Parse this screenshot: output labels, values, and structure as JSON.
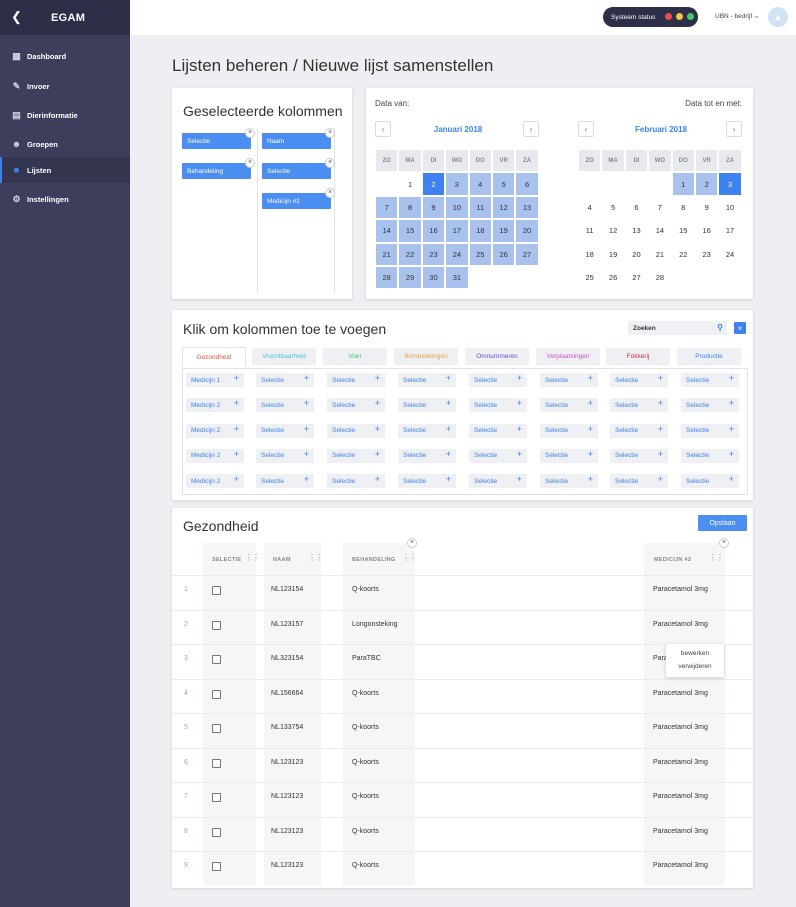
{
  "app": {
    "title": "EGAM",
    "back_icon": "chevron-left-icon"
  },
  "sidebar": {
    "items": [
      {
        "label": "Dashboard",
        "icon": "bar-chart-icon"
      },
      {
        "label": "Invoer",
        "icon": "edit-icon"
      },
      {
        "label": "Dierinformatie",
        "icon": "document-icon"
      },
      {
        "label": "Groepen",
        "icon": "group-icon"
      },
      {
        "label": "Lijsten",
        "icon": "list-icon",
        "active": true
      },
      {
        "label": "Instellingen",
        "icon": "gear-icon"
      }
    ]
  },
  "topbar": {
    "status_label": "Systeem status",
    "status_colors": [
      "#e84c4c",
      "#f5c542",
      "#4cc76a"
    ],
    "company": "UBN - bedrijf",
    "avatar_icon": "mountain-icon"
  },
  "page": {
    "title": "Lijsten beheren / Nieuwe lijst samenstellen"
  },
  "selected_columns": {
    "title": "Geselecteerde kolommen",
    "chips": [
      "Selectie",
      "Naam",
      "Behandeling",
      "Selectie",
      "Medicijn #2"
    ]
  },
  "calendar": {
    "from_label": "Data van:",
    "to_label": "Data tot en met:",
    "weekdays": [
      "ZO",
      "MA",
      "DI",
      "WO",
      "DO",
      "VR",
      "ZA"
    ],
    "left": {
      "month": "Januari 2018",
      "days": [
        "",
        "1",
        "2",
        "3",
        "4",
        "5",
        "6",
        "7",
        "8",
        "9",
        "10",
        "11",
        "12",
        "13",
        "14",
        "15",
        "16",
        "17",
        "18",
        "19",
        "20",
        "21",
        "22",
        "23",
        "24",
        "25",
        "26",
        "27",
        "28",
        "29",
        "30",
        "31",
        "",
        "",
        ""
      ],
      "selected": [
        "2"
      ],
      "range_from": "3",
      "range_to": "31"
    },
    "right": {
      "month": "Februari 2018",
      "days": [
        "",
        "",
        "",
        "",
        "1",
        "2",
        "3",
        "4",
        "5",
        "6",
        "7",
        "8",
        "9",
        "10",
        "11",
        "12",
        "13",
        "14",
        "15",
        "16",
        "17",
        "18",
        "19",
        "20",
        "21",
        "22",
        "23",
        "24",
        "25",
        "26",
        "27",
        "28",
        "",
        "",
        ""
      ],
      "selected": [
        "3"
      ],
      "range_from": "1",
      "range_to": "2"
    }
  },
  "add_columns": {
    "title": "Klik om kolommen toe te voegen",
    "search_placeholder": "Zoeken",
    "tabs": [
      {
        "label": "Gezondheid",
        "color": "#e8563c"
      },
      {
        "label": "Vruchtbaarheid",
        "color": "#4fc3d9"
      },
      {
        "label": "Voer",
        "color": "#3cc75f"
      },
      {
        "label": "Behandelingen",
        "color": "#f0a040"
      },
      {
        "label": "Omnummeren",
        "color": "#6a4ed8"
      },
      {
        "label": "Verplaatsingen",
        "color": "#d653c9"
      },
      {
        "label": "Fokkerij",
        "color": "#c7304a"
      },
      {
        "label": "Productie",
        "color": "#3d82f0"
      }
    ],
    "rows": [
      [
        "Medicijn 1",
        "Selectie",
        "Selectie",
        "Selectie",
        "Selectie",
        "Selectie",
        "Selectie",
        "Selectie"
      ],
      [
        "Medicijn 2",
        "Selectie",
        "Selectie",
        "Selectie",
        "Selectie",
        "Selectie",
        "Selectie",
        "Selectie"
      ],
      [
        "Medicijn 2",
        "Selectie",
        "Selectie",
        "Selectie",
        "Selectie",
        "Selectie",
        "Selectie",
        "Selectie"
      ],
      [
        "Medicijn 2",
        "Selectie",
        "Selectie",
        "Selectie",
        "Selectie",
        "Selectie",
        "Selectie",
        "Selectie"
      ],
      [
        "Medicijn 2",
        "Selectie",
        "Selectie",
        "Selectie",
        "Selectie",
        "Selectie",
        "Selectie",
        "Selectie"
      ]
    ]
  },
  "table": {
    "title": "Gezondheid",
    "save_label": "Opslaan",
    "headers": [
      "SELECTIE",
      "NAAM",
      "BEHANDELING",
      "MEDICIJN #2"
    ],
    "rows": [
      {
        "n": "1",
        "naam": "NL123154",
        "behandeling": "Q-koorts",
        "medicijn": "Paracetamol 3mg"
      },
      {
        "n": "2",
        "naam": "NL123157",
        "behandeling": "Longonsteking",
        "medicijn": "Paracetamol 3mg"
      },
      {
        "n": "3",
        "naam": "NL323154",
        "behandeling": "ParaTBC",
        "medicijn": "Para"
      },
      {
        "n": "4",
        "naam": "NL156664",
        "behandeling": "Q-koorts",
        "medicijn": "Paracetamol 3mg"
      },
      {
        "n": "5",
        "naam": "NL133754",
        "behandeling": "Q-koorts",
        "medicijn": "Paracetamol 3mg"
      },
      {
        "n": "6",
        "naam": "NL123123",
        "behandeling": "Q-koorts",
        "medicijn": "Paracetamol 3mg"
      },
      {
        "n": "7",
        "naam": "NL123123",
        "behandeling": "Q-koorts",
        "medicijn": "Paracetamol 3mg"
      },
      {
        "n": "8",
        "naam": "NL123123",
        "behandeling": "Q-koorts",
        "medicijn": "Paracetamol 3mg"
      },
      {
        "n": "9",
        "naam": "NL123123",
        "behandeling": "Q-koorts",
        "medicijn": "Paracetamol 3mg"
      }
    ],
    "context_menu": [
      "bewerken",
      "verwijderen"
    ]
  }
}
